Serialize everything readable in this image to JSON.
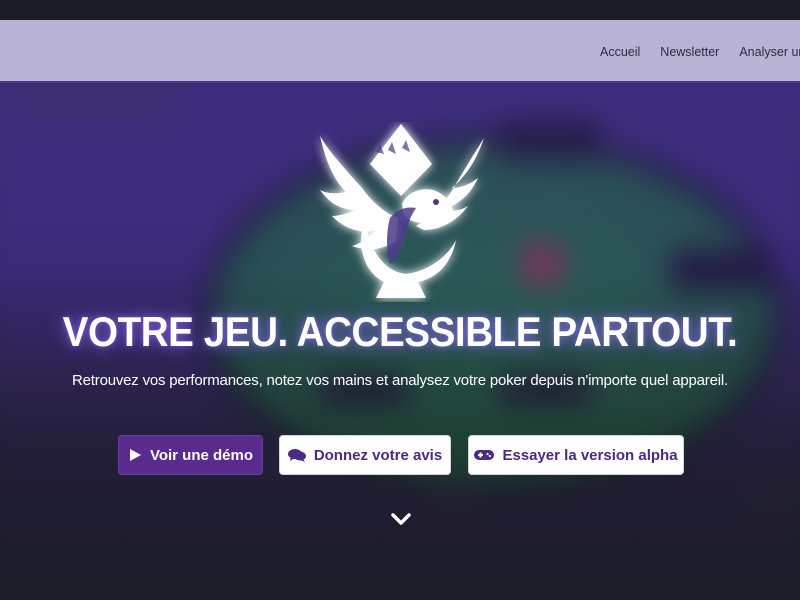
{
  "navbar": {
    "links": [
      "Accueil",
      "Newsletter",
      "Analyser une"
    ]
  },
  "hero": {
    "title": "VOTRE JEU. ACCESSIBLE PARTOUT.",
    "subtitle": "Retrouvez vos performances, notez vos mains et analysez votre poker depuis n'importe quel appareil.",
    "buttons": {
      "demo": {
        "label": "Voir une démo",
        "icon": "play-icon"
      },
      "feedback": {
        "label": "Donnez votre avis",
        "icon": "comments-icon"
      },
      "alpha": {
        "label": "Essayer la version alpha",
        "icon": "gamepad-icon"
      }
    },
    "scroll_icon": "chevron-down-icon"
  },
  "colors": {
    "navbar_bg": "#b9b3d6",
    "primary_button": "#5a2b8e",
    "outline_text": "#4a2b82",
    "background_overlay": "#3b2d70"
  }
}
